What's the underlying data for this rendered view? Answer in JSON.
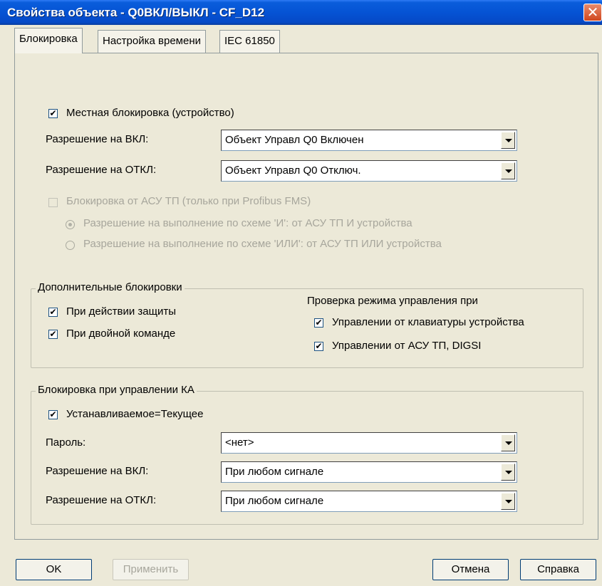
{
  "window": {
    "title": "Свойства объекта - Q0ВКЛ/ВЫКЛ - CF_D12",
    "close_glyph": "✕"
  },
  "tabs": [
    {
      "label": "Блокировка"
    },
    {
      "label": "Настройка времени"
    },
    {
      "label": "IEC 61850"
    }
  ],
  "local_lock": {
    "label": "Местная блокировка (устройство)",
    "checked": true,
    "on_label": "Разрешение на ВКЛ:",
    "on_value": "Объект Управл   Q0 Включен",
    "off_label": "Разрешение на ОТКЛ:",
    "off_value": "Объект Управл   Q0 Отключ."
  },
  "scada_lock": {
    "label": "Блокировка от АСУ ТП (только при Profibus FMS)",
    "radio_and": "Разрешение на выполнение по схеме 'И': от АСУ ТП И устройства",
    "radio_or": "Разрешение на выполнение по схеме 'ИЛИ': от АСУ ТП ИЛИ устройства"
  },
  "extra_locks": {
    "legend": "Дополнительные блокировки",
    "protection": "При действии защиты",
    "double_cmd": "При двойной команде",
    "mode_check_title": "Проверка режима управления при",
    "keypad": "Управлении от клавиатуры устройства",
    "scada_digsi": "Управлении от АСУ ТП, DIGSI"
  },
  "switch_lock": {
    "legend": "Блокировка при управлении КА",
    "set_eq_current": "Устанавливаемое=Текущее",
    "password_label": "Пароль:",
    "password_value": "<нет>",
    "on_label": "Разрешение на ВКЛ:",
    "on_value": "При любом сигнале",
    "off_label": "Разрешение на ОТКЛ:",
    "off_value": "При любом сигнале"
  },
  "buttons": {
    "ok": "OK",
    "apply": "Применить",
    "cancel": "Отмена",
    "help": "Справка"
  },
  "check_glyph": "✔"
}
